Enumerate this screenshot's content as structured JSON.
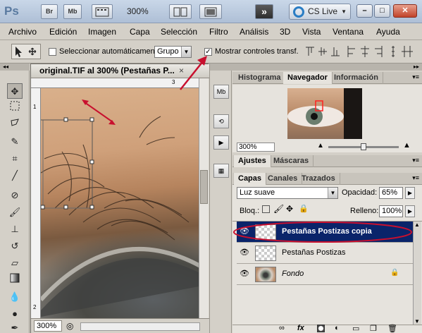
{
  "app": {
    "logo": "Ps",
    "bridge_label": "Br",
    "minibridge_label": "Mb",
    "zoom": "300%",
    "cslive_label": "CS Live",
    "workspace_button": "»",
    "win_min": "–",
    "win_max": "□",
    "win_close": "✕"
  },
  "menu": [
    "Archivo",
    "Edición",
    "Imagen",
    "Capa",
    "Selección",
    "Filtro",
    "Análisis",
    "3D",
    "Vista",
    "Ventana",
    "Ayuda"
  ],
  "options": {
    "auto_select_label": "Seleccionar automáticamente:",
    "auto_select_checked": false,
    "group_value": "Grupo",
    "show_transform_label": "Mostrar controles transf.",
    "show_transform_checked": true
  },
  "document": {
    "title": "original.TIF al 300% (Pestañas P...",
    "close": "×",
    "ruler_h_mark": "3",
    "ruler_v_mark1": "1",
    "ruler_v_mark2": "2",
    "zoom_status": "300%"
  },
  "navigator": {
    "tabs": [
      "Histograma",
      "Navegador",
      "Información"
    ],
    "active_tab": "Navegador",
    "zoom": "300%"
  },
  "adjustments": {
    "tabs": [
      "Ajustes",
      "Máscaras"
    ]
  },
  "layers_panel": {
    "tabs": [
      "Capas",
      "Canales",
      "Trazados"
    ],
    "blend_mode": "Luz suave",
    "opacity_label": "Opacidad:",
    "opacity_value": "65%",
    "lock_label": "Bloq.:",
    "fill_label": "Relleno:",
    "fill_value": "100%",
    "layers": [
      {
        "name": "Pestañas Postizas copia",
        "selected": true
      },
      {
        "name": "Pestañas Postizas",
        "selected": false
      },
      {
        "name": "Fondo",
        "selected": false
      }
    ],
    "footer_icons": [
      "link-icon",
      "fx-icon",
      "mask-icon",
      "adjustment-icon",
      "group-icon",
      "new-layer-icon",
      "trash-icon"
    ],
    "footer_fx": "fx"
  },
  "colors": {
    "selection": "#0a246a",
    "annotation_red": "#c8102e"
  }
}
